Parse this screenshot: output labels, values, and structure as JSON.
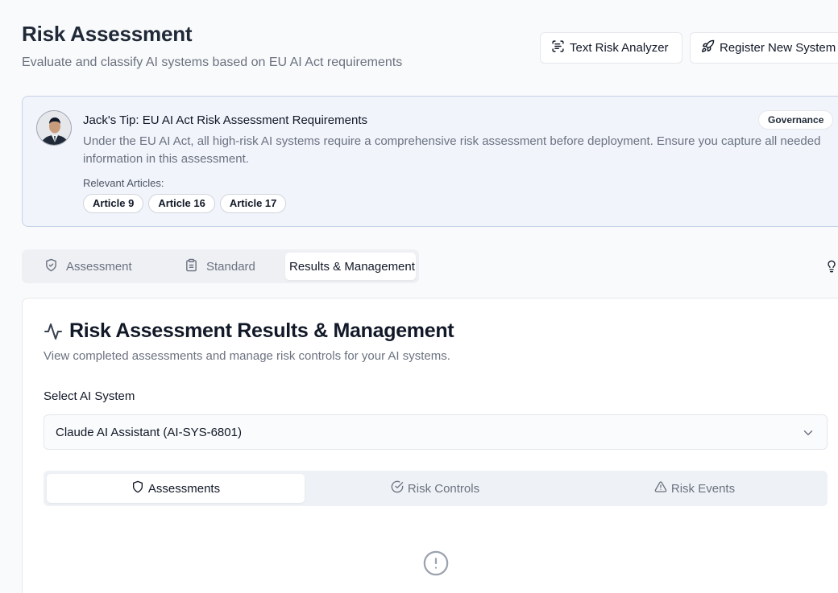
{
  "header": {
    "title": "Risk Assessment",
    "subtitle": "Evaluate and classify AI systems based on EU AI Act requirements",
    "text_risk_analyzer_label": "Text Risk Analyzer",
    "register_system_label": "Register New System"
  },
  "tip": {
    "title": "Jack's Tip: EU AI Act Risk Assessment Requirements",
    "badge": "Governance",
    "body": "Under the EU AI Act, all high-risk AI systems require a comprehensive risk assessment before deployment. Ensure you capture all needed information in this assessment.",
    "relevant_label": "Relevant Articles:",
    "articles": [
      "Article 9",
      "Article 16",
      "Article 17"
    ]
  },
  "tabs": {
    "assessment": "Assessment",
    "standard": "Standard",
    "results": "Results & Management",
    "active": "results"
  },
  "results": {
    "title": "Risk Assessment Results & Management",
    "subtitle": "View completed assessments and manage risk controls for your AI systems.",
    "select_label": "Select AI System",
    "selected_system": "Claude AI Assistant (AI-SYS-6801)",
    "subtabs": {
      "assessments": "Assessments",
      "risk_controls": "Risk Controls",
      "risk_events": "Risk Events",
      "active": "assessments"
    }
  },
  "icons": {
    "analyzer": "scan-text-icon",
    "register": "rocket-icon",
    "assessment_tab": "shield-check-icon",
    "standard_tab": "clipboard-icon",
    "tips": "lightbulb-icon",
    "results": "activity-icon",
    "empty_state": "alert-circle-icon"
  },
  "colors": {
    "accent_border": "#c7d2e8",
    "tip_background": "#f1f4fb",
    "muted_text": "#6b7280"
  }
}
